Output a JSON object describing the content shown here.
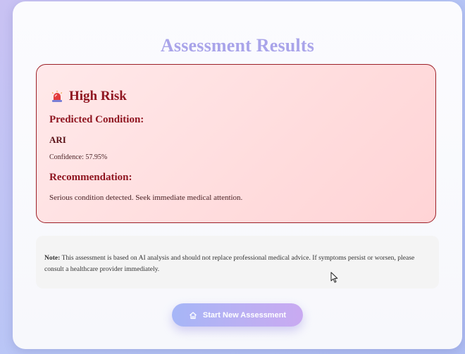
{
  "page": {
    "title": "Assessment Results"
  },
  "result": {
    "risk_icon": "siren-icon",
    "risk_level": "High Risk",
    "condition_heading": "Predicted Condition:",
    "condition": "ARI",
    "confidence": "Confidence: 57.95%",
    "recommendation_heading": "Recommendation:",
    "recommendation": "Serious condition detected. Seek immediate medical attention."
  },
  "note": {
    "label": "Note:",
    "text": " This assessment is based on AI analysis and should not replace professional medical advice. If symptoms persist or worsen, please consult a healthcare provider immediately."
  },
  "actions": {
    "icon": "home-icon",
    "start_new_label": "Start New Assessment"
  },
  "colors": {
    "title": "#a9a4ea",
    "risk_accent": "#8f1520",
    "risk_border": "#9c1f27",
    "risk_background": "#ffdcdd",
    "note_background": "#f4f4f4",
    "button_gradient_start": "#a6b6f7",
    "button_gradient_end": "#c9aaf1"
  }
}
